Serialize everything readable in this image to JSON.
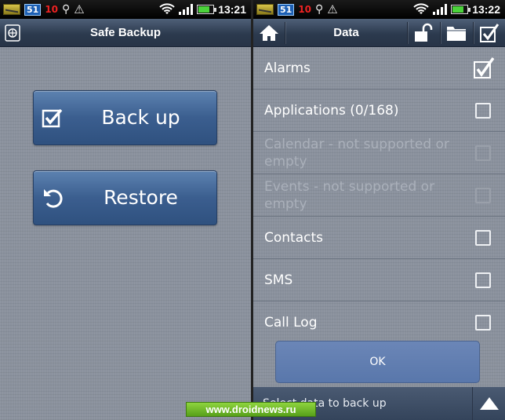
{
  "left_screen": {
    "status": {
      "badge": "51",
      "red_count": "10",
      "time": "13:21"
    },
    "title": "Safe Backup",
    "backup_button": {
      "label": "Back up",
      "icon": "checkbox-icon"
    },
    "restore_button": {
      "label": "Restore",
      "icon": "undo-icon"
    }
  },
  "right_screen": {
    "status": {
      "badge": "51",
      "red_count": "10",
      "time": "13:22"
    },
    "title": "Data",
    "items": [
      {
        "label": "Alarms",
        "checked": true,
        "disabled": false
      },
      {
        "label": "Applications (0/168)",
        "checked": false,
        "disabled": false
      },
      {
        "label": "Calendar - not supported or empty",
        "checked": false,
        "disabled": true
      },
      {
        "label": "Events - not supported or empty",
        "checked": false,
        "disabled": true
      },
      {
        "label": "Contacts",
        "checked": false,
        "disabled": false
      },
      {
        "label": "SMS",
        "checked": false,
        "disabled": false
      },
      {
        "label": "Call Log",
        "checked": false,
        "disabled": false
      }
    ],
    "ok_label": "OK",
    "footer_text": "Select data to back up"
  },
  "watermark": "www.droidnews.ru",
  "colors": {
    "accent": "#3b5e8f",
    "list_bg": "#8a919d",
    "ok_button": "#6179ad",
    "watermark": "#6fb82a"
  }
}
